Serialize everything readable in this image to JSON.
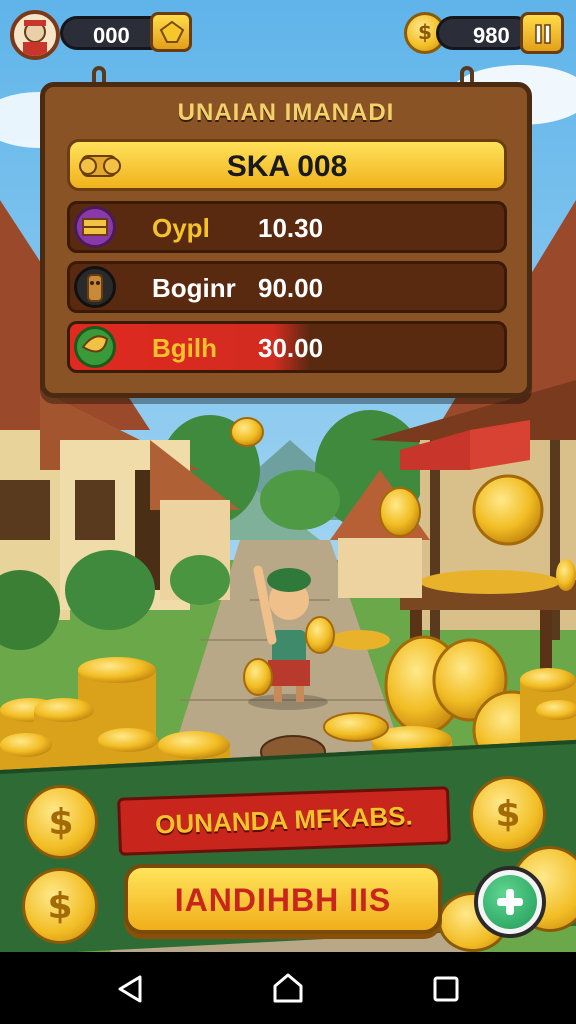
{
  "hud": {
    "left_counter": "000",
    "right_counter": "980"
  },
  "board": {
    "title": "UNAIAN IMANADI",
    "banner": "SKA 008",
    "rows": [
      {
        "label": "Oypl",
        "value": "10.30"
      },
      {
        "label": "Boginr",
        "value": "90.00"
      },
      {
        "label": "Bgilh",
        "value": "30.00"
      }
    ]
  },
  "footer": {
    "ribbon_text": "OUNANDA MFKABS.",
    "main_button_label": "IANDIHBH IIS"
  },
  "colors": {
    "gold": "#f4c22b",
    "wood": "#8a5326",
    "red": "#d22b20",
    "green_panel": "#2f6b35"
  },
  "icons": {
    "avatar": "avatar-portrait-icon",
    "gem": "gold-gem-icon",
    "coin": "dollar-coin-icon",
    "pause": "pause-icon",
    "plus": "plus-icon",
    "back": "back-triangle-icon",
    "home": "home-icon",
    "recents": "recents-square-icon"
  }
}
